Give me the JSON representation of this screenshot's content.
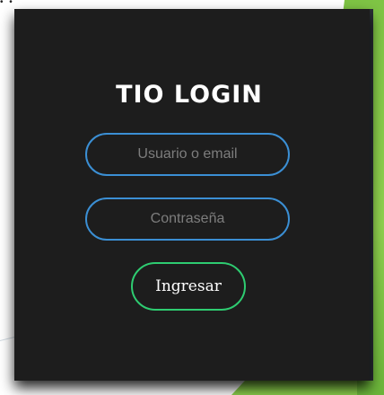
{
  "login": {
    "title": "TIO LOGIN",
    "username_placeholder": "Usuario o email",
    "password_placeholder": "Contraseña",
    "submit_label": "Ingresar"
  },
  "colors": {
    "card_background": "#1d1d1d",
    "field_border": "#3b8fd4",
    "button_border": "#2ecc71",
    "accent_green": "#8cd14c"
  }
}
